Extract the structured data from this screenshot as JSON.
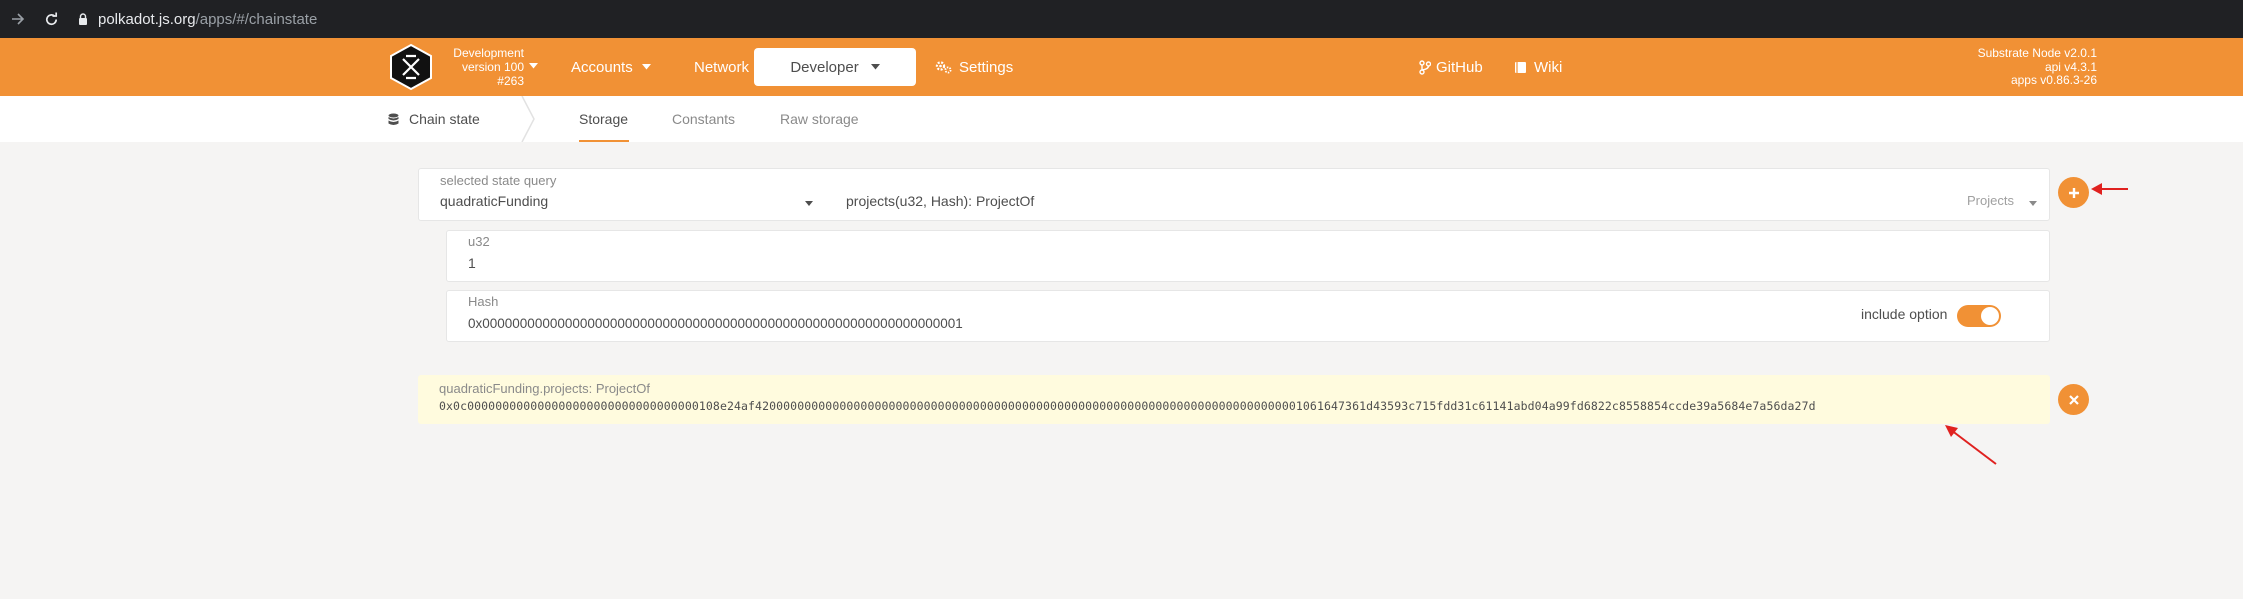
{
  "browser": {
    "url_domain": "polkadot.js.org",
    "url_path": "/apps/#/chainstate"
  },
  "header": {
    "chain_name": "Development",
    "chain_version": "version 100",
    "block": "#263",
    "menu": {
      "accounts": "Accounts",
      "network": "Network",
      "developer": "Developer",
      "settings": "Settings",
      "github": "GitHub",
      "wiki": "Wiki"
    },
    "versions": {
      "node": "Substrate Node v2.0.1",
      "api": "api v4.3.1",
      "apps": "apps v0.86.3-26"
    }
  },
  "subnav": {
    "section": "Chain state",
    "tabs": [
      "Storage",
      "Constants",
      "Raw storage"
    ],
    "active_tab": "Storage"
  },
  "query": {
    "label": "selected state query",
    "module": "quadraticFunding",
    "method": "projects(u32, Hash): ProjectOf",
    "doc_hint": "Projects"
  },
  "params": [
    {
      "label": "u32",
      "value": "1"
    },
    {
      "label": "Hash",
      "value": "0x0000000000000000000000000000000000000000000000000000000000000001",
      "option_label": "include option",
      "option_enabled": true
    }
  ],
  "result": {
    "label": "quadraticFunding.projects: ProjectOf",
    "value": "0x0c000000000000000000000000000000000108e24af420000000000000000000000000000000000000000000000000000000000000000000000000001061647361d43593c715fdd31c61141abd04a99fd6822c8558854ccde39a5684e7a56da27d"
  },
  "colors": {
    "brand": "#f19135",
    "annotation": "#e0211f",
    "result_bg": "#fffbde"
  },
  "icons": {
    "add": "plus-icon",
    "close": "close-icon",
    "settings": "cog-icon",
    "github": "git-branch-icon",
    "wiki": "book-icon",
    "section": "database-icon"
  }
}
